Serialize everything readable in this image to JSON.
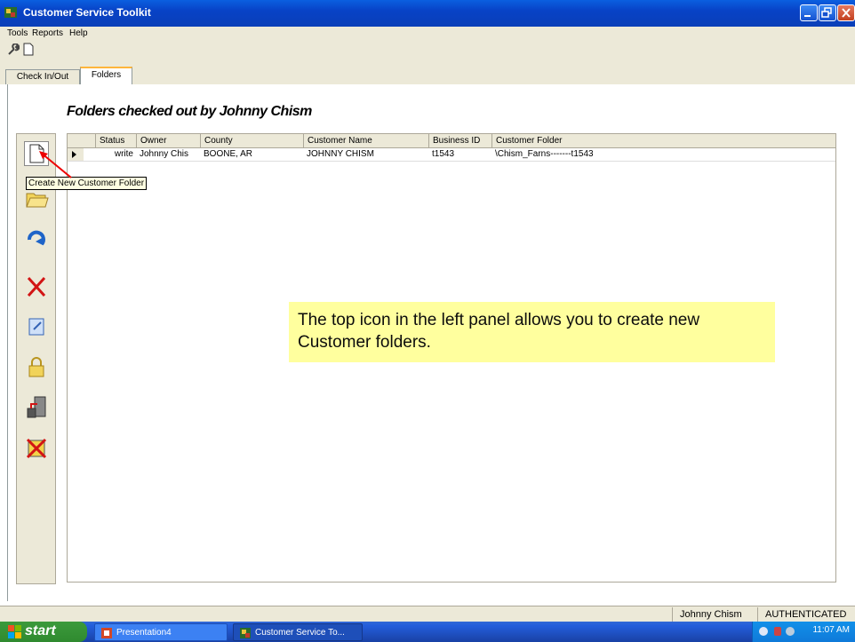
{
  "window": {
    "title": "Customer Service Toolkit"
  },
  "menu": [
    "Tools",
    "Reports",
    "Help"
  ],
  "tabs": [
    {
      "label": "Check In/Out",
      "active": false
    },
    {
      "label": "Folders",
      "active": true
    }
  ],
  "heading": "Folders checked out by Johnny Chism",
  "sidebar": {
    "buttons": [
      {
        "name": "new-folder",
        "icon": "new-document-icon"
      },
      {
        "name": "open-folder",
        "icon": "open-folder-icon"
      },
      {
        "name": "refresh",
        "icon": "refresh-arrow-icon"
      },
      {
        "name": "delete",
        "icon": "red-x-icon"
      },
      {
        "name": "check-in",
        "icon": "edit-document-icon"
      },
      {
        "name": "lock",
        "icon": "padlock-icon"
      },
      {
        "name": "transfer",
        "icon": "transfer-icon"
      },
      {
        "name": "remove",
        "icon": "crossed-box-icon"
      }
    ],
    "tooltip": "Create New Customer Folder"
  },
  "grid": {
    "columns": [
      "Status",
      "Owner",
      "County",
      "Customer Name",
      "Business ID",
      "Customer Folder"
    ],
    "rows": [
      [
        "write",
        "Johnny Chis",
        "BOONE, AR",
        "JOHNNY CHISM",
        "t1543",
        "\\Chism_Farns-------t1543"
      ]
    ]
  },
  "callout": "The top icon in the left panel allows you to create new Customer folders.",
  "status": {
    "user": "Johnny Chism",
    "auth": "AUTHENTICATED"
  },
  "taskbar": {
    "start": "start",
    "items": [
      "Presentation4",
      "Customer Service To..."
    ],
    "clock": "11:07 AM"
  },
  "colors": {
    "titlebar": "#0a4fd6",
    "callout": "#ffff99",
    "taskbar": "#245edb"
  }
}
